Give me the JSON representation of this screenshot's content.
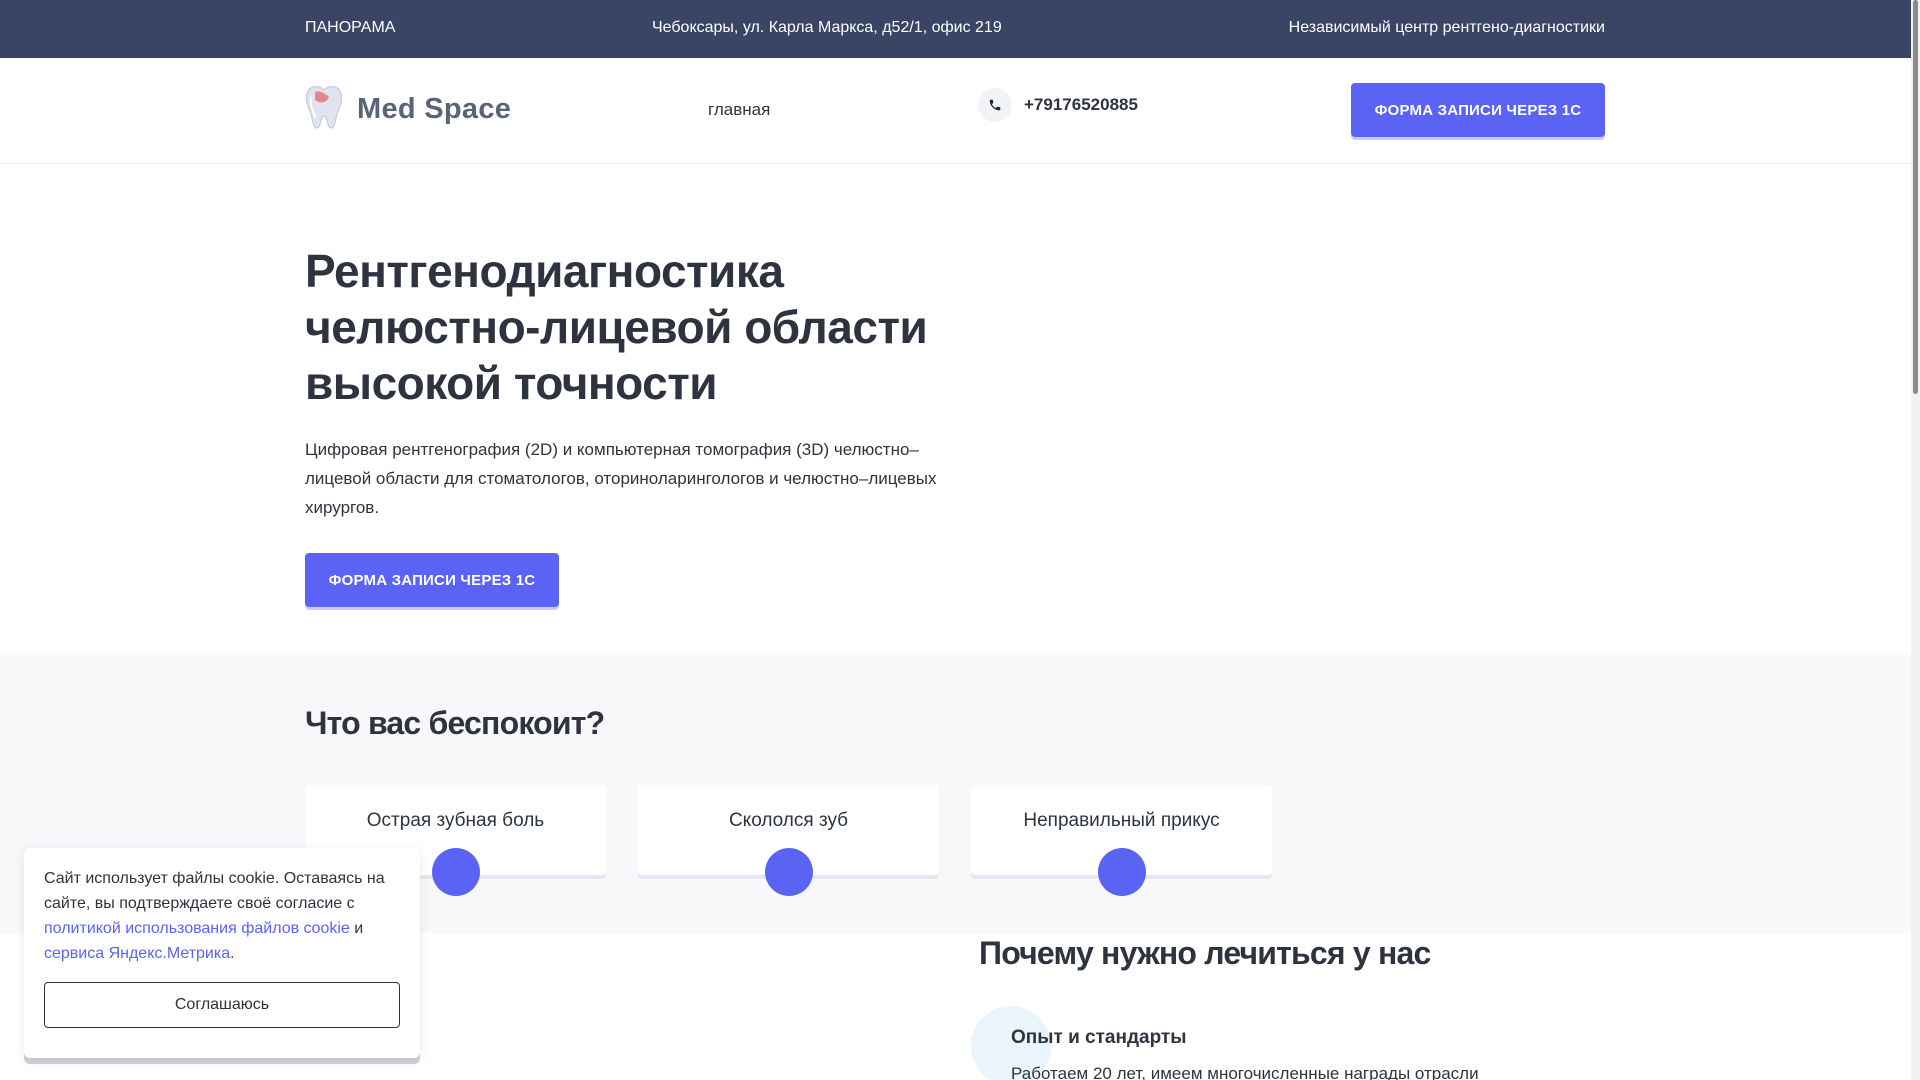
{
  "topbar": {
    "left": "ПАНОРАМА",
    "address": "Чебоксары,  ул. Карла Маркса, д52/1, офис 219",
    "tagline": "Независимый центр рентгено-диагностики"
  },
  "header": {
    "logo_text": "Med Space",
    "nav_home": "главная",
    "phone": "+79176520885",
    "cta": "ФОРМА ЗАПИСИ ЧЕРЕЗ 1С"
  },
  "hero": {
    "title_line1": "Рентгенодиагностика",
    "title_line2": "челюстно-лицевой области",
    "title_line3": "высокой точности",
    "description": "Цифровая рентгенография (2D) и компьютерная томография (3D) челюстно–лицевой области для стоматологов, оториноларингологов и челюстно–лицевых хирургов.",
    "cta": "ФОРМА ЗАПИСИ ЧЕРЕЗ 1С"
  },
  "concerns": {
    "title": "Что вас беспокоит?",
    "items": [
      {
        "label": "Острая зубная боль"
      },
      {
        "label": "Скололся зуб"
      },
      {
        "label": "Неправильный прикус"
      }
    ]
  },
  "why": {
    "title": "Почему нужно лечиться у нас",
    "item_title": "Опыт и стандарты",
    "item_text": "Работаем 20 лет, имеем многочисленные награды отрасли"
  },
  "cookie": {
    "text_before": "Сайт использует файлы cookie. Оставаясь на сайте, вы подтверждаете своё согласие с ",
    "link1": "политикой использования файлов cookie",
    "text_mid": " и ",
    "link2": "сервиса Яндекс.Метрика",
    "text_after": ".",
    "button": "Соглашаюсь"
  },
  "colors": {
    "topbar_bg": "#3a4566",
    "accent": "#5b63f5",
    "text": "#2d3440",
    "section_bg": "#f8f8fb"
  },
  "icons": {
    "logo": "tooth-icon",
    "phone": "phone-icon"
  }
}
